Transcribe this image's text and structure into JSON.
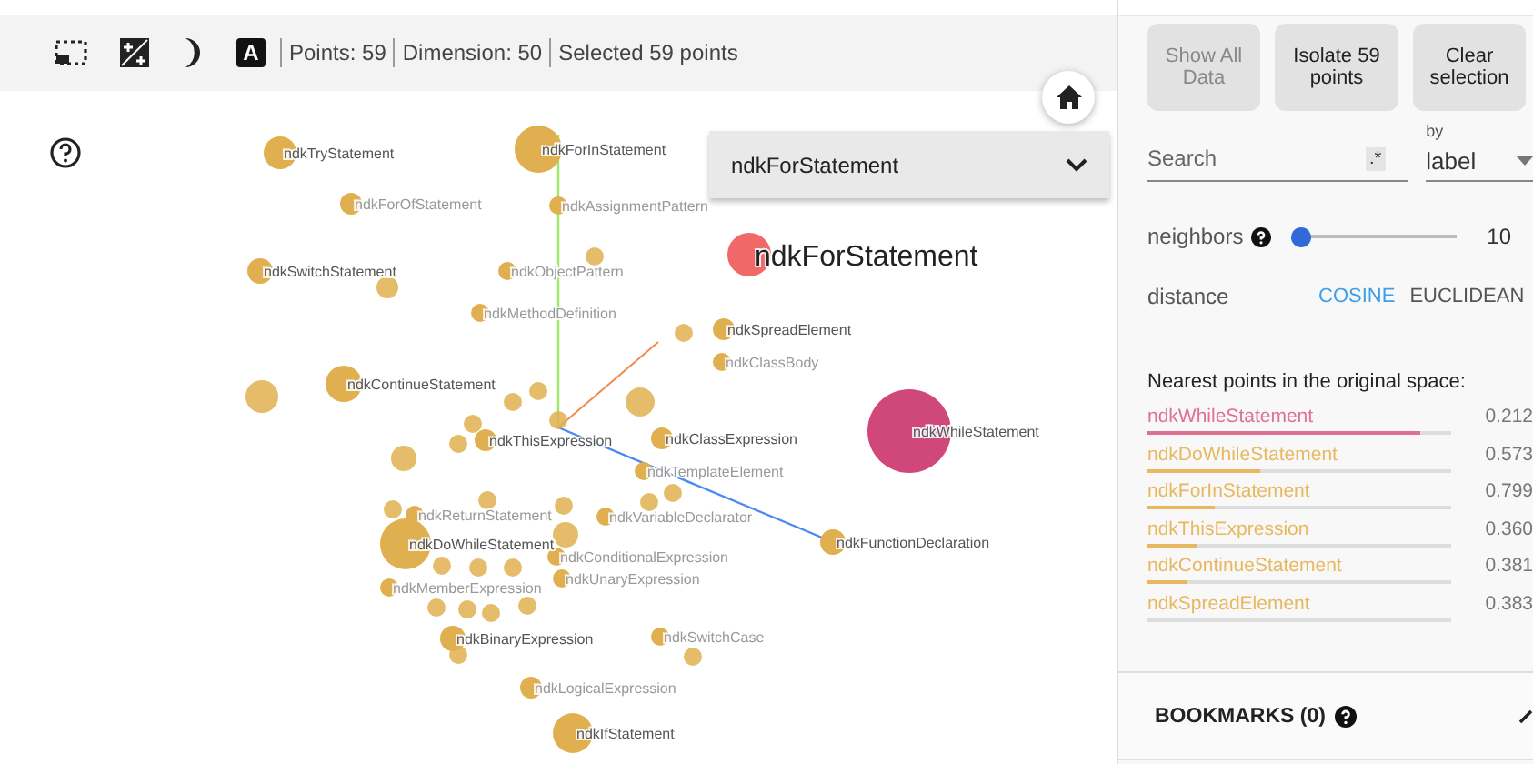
{
  "toolbar": {
    "label_toggle": "A",
    "stats": [
      "Points: 59",
      "Dimension: 50",
      "Selected 59 points"
    ]
  },
  "dropdown": {
    "value": "ndkForStatement"
  },
  "points": [
    {
      "label": "ndkTryStatement",
      "kind": "label",
      "color": "#e0b050"
    },
    {
      "label": "ndkForInStatement",
      "kind": "label",
      "color": "#e0b050"
    },
    {
      "label": "ndkForOfStatement",
      "kind": "dim",
      "color": "#e0b050"
    },
    {
      "label": "ndkAssignmentPattern",
      "kind": "dim",
      "color": "#e0b050"
    },
    {
      "label": "ndkSwitchStatement",
      "kind": "label",
      "color": "#e0b050"
    },
    {
      "label": "ndkObjectPattern",
      "kind": "dim",
      "color": "#e0b050"
    },
    {
      "label": "ndkMethodDefinition",
      "kind": "dim",
      "color": "#e0b050"
    },
    {
      "label": "ndkSpreadElement",
      "kind": "label",
      "color": "#e0b050"
    },
    {
      "label": "ndkClassBody",
      "kind": "dim",
      "color": "#e0b050"
    },
    {
      "label": "ndkContinueStatement",
      "kind": "label",
      "color": "#e0b050"
    },
    {
      "label": "ndkThisExpression",
      "kind": "label",
      "color": "#e0b050"
    },
    {
      "label": "ndkClassExpression",
      "kind": "label",
      "color": "#e0b050"
    },
    {
      "label": "ndkTemplateElement",
      "kind": "dim",
      "color": "#e0b050"
    },
    {
      "label": "ndkReturnStatement",
      "kind": "dim",
      "color": "#e0b050"
    },
    {
      "label": "ndkVariableDeclarator",
      "kind": "dim",
      "color": "#e0b050"
    },
    {
      "label": "ndkDoWhileStatement",
      "kind": "label",
      "color": "#e0b050"
    },
    {
      "label": "ndkFunctionDeclaration",
      "kind": "label",
      "color": "#e0b050"
    },
    {
      "label": "ndkConditionalExpression",
      "kind": "dim",
      "color": "#e0b050"
    },
    {
      "label": "ndkUnaryExpression",
      "kind": "dim",
      "color": "#e0b050"
    },
    {
      "label": "ndkMemberExpression",
      "kind": "dim",
      "color": "#e0b050"
    },
    {
      "label": "ndkBinaryExpression",
      "kind": "label",
      "color": "#e0b050"
    },
    {
      "label": "ndkSwitchCase",
      "kind": "dim",
      "color": "#e0b050"
    },
    {
      "label": "ndkLogicalExpression",
      "kind": "dim",
      "color": "#e0b050"
    },
    {
      "label": "ndkIfStatement",
      "kind": "label",
      "color": "#e0b050"
    },
    {
      "label": "ndkForStatement",
      "kind": "focus",
      "color": "#f06868"
    },
    {
      "label": "ndkWhileStatement",
      "kind": "label",
      "color": "#d0487a"
    }
  ],
  "buttons": [
    {
      "label": "Show All Data",
      "disabled": true
    },
    {
      "label": "Isolate 59 points",
      "disabled": false
    },
    {
      "label": "Clear selection",
      "disabled": false
    }
  ],
  "search": {
    "placeholder": "Search",
    "regex": ".*"
  },
  "by": {
    "label": "by",
    "value": "label"
  },
  "neighbors": {
    "label": "neighbors",
    "level": 0.05,
    "value": "10"
  },
  "distance": {
    "label": "distance",
    "options": [
      {
        "label": "COSINE",
        "selected": true
      },
      {
        "label": "EUCLIDEAN",
        "selected": false
      }
    ]
  },
  "nearest": {
    "title": "Nearest points in the original space:",
    "rows": [
      {
        "name": "ndkWhileStatement",
        "value": "0.212",
        "level": 0.9,
        "color": "#e0708f"
      },
      {
        "name": "ndkDoWhileStatement",
        "value": "0.573",
        "level": 0.37,
        "color": "#e8b860"
      },
      {
        "name": "ndkForInStatement",
        "value": "0.799",
        "level": 0.22,
        "color": "#e8b860"
      },
      {
        "name": "ndkThisExpression",
        "value": "0.360",
        "level": 0.16,
        "color": "#e8b860"
      },
      {
        "name": "ndkContinueStatement",
        "value": "0.381",
        "level": 0.13,
        "color": "#e8b860"
      },
      {
        "name": "ndkSpreadElement",
        "value": "0.383",
        "color": "#e8b860"
      }
    ]
  },
  "bookmarks": {
    "title": "BOOKMARKS (0)"
  }
}
